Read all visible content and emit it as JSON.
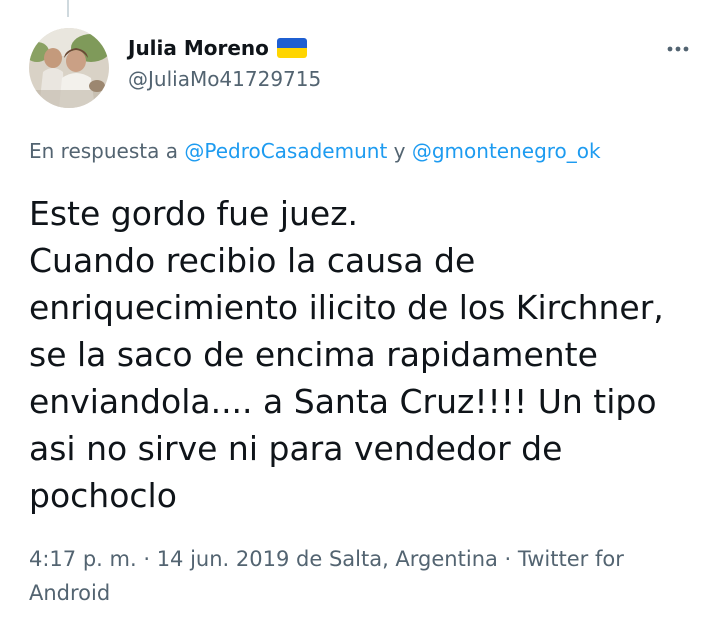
{
  "user": {
    "display_name": "Julia Moreno",
    "handle": "@JuliaMo41729715",
    "flag_icon": "ukraine-flag-icon",
    "avatar_alt": "profile photo"
  },
  "actions": {
    "more_icon": "more-horizontal-icon"
  },
  "reply": {
    "prefix": "En respuesta a ",
    "mention_1": "@PedroCasademunt",
    "joiner": " y ",
    "mention_2": "@gmontenegro_ok"
  },
  "tweet": {
    "text": "Este gordo fue juez.\nCuando recibio la causa de enriquecimiento ilicito de los Kirchner, se la saco de encima rapidamente enviandola.... a Santa Cruz!!!! Un tipo asi no sirve ni para vendedor de pochoclo"
  },
  "meta": {
    "time": "4:17 p. m.",
    "sep1": " · ",
    "date": "14 jun. 2019",
    "location": " de Salta, Argentina",
    "sep2": " · ",
    "source": "Twitter for Android"
  },
  "colors": {
    "text": "#0f1419",
    "secondary": "#536471",
    "link": "#1d9bf0",
    "flag_blue": "#1f5fd1",
    "flag_yellow": "#ffd500"
  }
}
